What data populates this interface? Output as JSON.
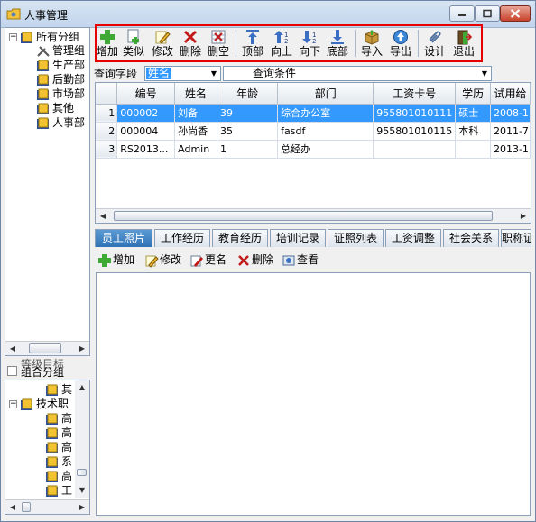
{
  "window": {
    "title": "人事管理"
  },
  "tree": {
    "root": "所有分组",
    "children": [
      "管理组",
      "生产部",
      "后勤部",
      "市场部",
      "其他",
      "人事部"
    ]
  },
  "group_mode": {
    "label": "组合分组",
    "shadow_text": "等级目标"
  },
  "tree2": {
    "items": [
      "其",
      "技术职",
      "高",
      "高",
      "高",
      "系",
      "高",
      "工"
    ]
  },
  "toolbar": {
    "buttons": [
      "增加",
      "类似",
      "修改",
      "删除",
      "删空",
      "顶部",
      "向上",
      "向下",
      "底部",
      "导入",
      "导出",
      "设计",
      "退出"
    ]
  },
  "query": {
    "field_label": "查询字段",
    "field_value": "姓名",
    "condition_label": "查询条件"
  },
  "grid": {
    "columns": [
      "编号",
      "姓名",
      "年龄",
      "部门",
      "工资卡号",
      "学历",
      "试用给"
    ],
    "rows": [
      {
        "n": "1",
        "id": "000002",
        "name": "刘备",
        "age": "39",
        "dept": "综合办公室",
        "card": "955801010111",
        "edu": "硕士",
        "trial": "2008-1"
      },
      {
        "n": "2",
        "id": "000004",
        "name": "孙尚香",
        "age": "35",
        "dept": "fasdf",
        "card": "955801010115",
        "edu": "本科",
        "trial": "2011-7"
      },
      {
        "n": "3",
        "id": "RS2013...",
        "name": "Admin",
        "age": "1",
        "dept": "总经办",
        "card": "",
        "edu": "",
        "trial": "2013-1"
      }
    ]
  },
  "tabs": [
    "员工照片",
    "工作经历",
    "教育经历",
    "培训记录",
    "证照列表",
    "工资调整",
    "社会关系",
    "职称证"
  ],
  "subtoolbar": {
    "buttons": [
      "增加",
      "修改",
      "更名",
      "删除",
      "查看"
    ]
  },
  "colors": {
    "selection": "#3399ff",
    "highlight_frame": "#e60000",
    "active_tab": "#2f73b6"
  }
}
